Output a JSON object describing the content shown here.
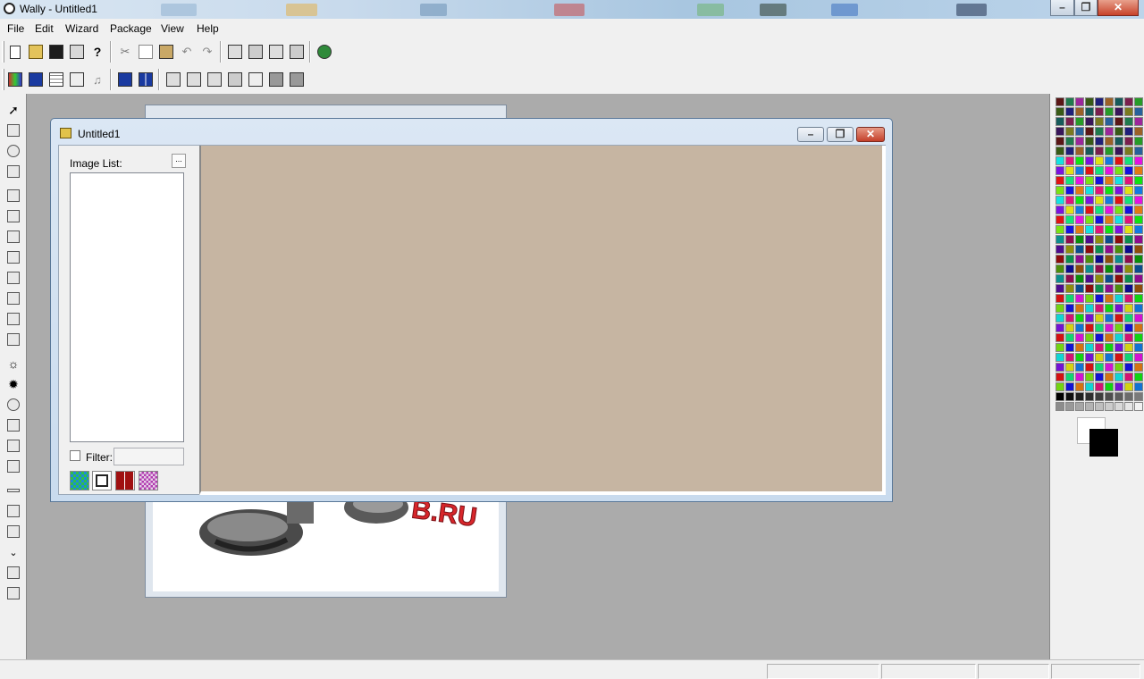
{
  "window": {
    "title": "Wally - Untitled1"
  },
  "menu": [
    "File",
    "Edit",
    "Wizard",
    "Package",
    "View",
    "Help"
  ],
  "child_window": {
    "title": "Untitled1",
    "image_list_label": "Image List:",
    "browse_button": "...",
    "filter_label": "Filter:",
    "filter_value": ""
  },
  "background_window": {
    "watermark_text": "B.RU"
  },
  "colors": {
    "preview_bg": "#c6b5a2",
    "workspace_bg": "#ababab",
    "foreground": "#000000",
    "background": "#ffffff"
  }
}
